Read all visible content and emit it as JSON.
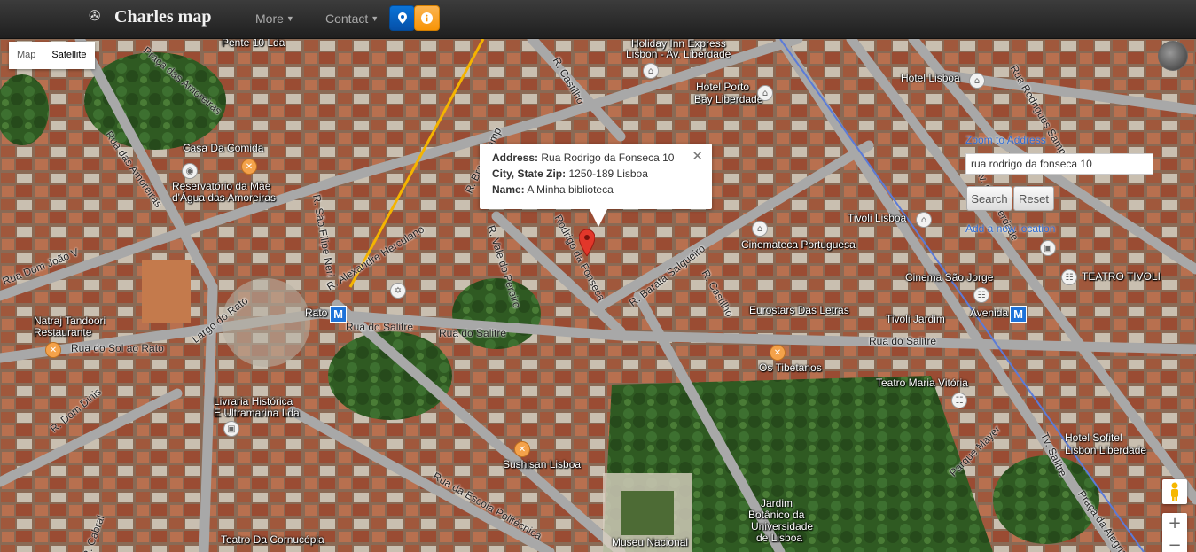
{
  "navbar": {
    "brand": "Charles map",
    "brand_icon": "compass-icon",
    "menu": [
      {
        "label": "More"
      },
      {
        "label": "Contact"
      }
    ],
    "buttons": [
      {
        "icon": "map-marker-icon",
        "color": "#0a63c6"
      },
      {
        "icon": "info-icon",
        "color": "#f89406"
      }
    ]
  },
  "map_type": {
    "map_label": "Map",
    "satellite_label": "Satellite",
    "selected": "Satellite"
  },
  "info_window": {
    "address_label": "Address:",
    "address": "Rua Rodrigo da Fonseca 10",
    "city_label": "City, State Zip:",
    "city": "1250-189 Lisboa",
    "name_label": "Name:",
    "name": "A Minha biblioteca",
    "close_icon": "close-icon"
  },
  "panel": {
    "zoom_link": "Zoom to Address",
    "search_value": "rua rodrigo da fonseca 10",
    "search_label": "Search",
    "reset_label": "Reset",
    "add_link": "Add a new location"
  },
  "zoom": {
    "in": "+",
    "out": "−"
  },
  "map_labels": {
    "poi": [
      "Pente 10 Lda",
      "Holiday Inn Express",
      "Lisbon - Av. Liberdade",
      "Hotel Porto",
      "Bay Liberdade",
      "Hotel Lisboa",
      "Casa Da Comida",
      "Reservatório da Mãe",
      "d'Água das Amoreiras",
      "Tivoli Lisboa",
      "Cinemateca Portuguesa",
      "Cinema São Jorge",
      "TEATRO TIVOLI",
      "Natraj Tandoori",
      "Restaurante",
      "Eurostars Das Letras",
      "Tivoli Jardim",
      "Avenida",
      "Rato",
      "Os Tibetanos",
      "Teatro Maria Vitória",
      "Livraria Histórica",
      "E Ultramarina Lda",
      "Hotel Sofitel",
      "Lisbon Liberdade",
      "Sushisan Lisboa",
      "Jardim",
      "Botânico da",
      "Universidade",
      "de Lisboa",
      "Teatro Da Cornucópia",
      "Museu Nacional"
    ],
    "roads": [
      "Praça das Amoreiras",
      "Rua das Amoreiras",
      "R. São Filipe Neri",
      "R. Braamcamp",
      "R. Castilho",
      "R. Alexandre Herculano",
      "Rua Dom João V",
      "Largo do Rato",
      "R. Vale do Pereiro",
      "Rodrigo da Fonseca",
      "R. Barata Salgueiro",
      "Rua do Salitre",
      "Rua do Sol ao Rato",
      "R. Dom Dinis",
      "Rua da Escola Politécnica",
      "Av. da Liberdade",
      "Praça da Alegria",
      "R. Castilho",
      "Rua do Salitre",
      "Rua do Salitre",
      "Parque Mayer",
      "Tv. Salitre",
      "Rua Rodrigues Sampaio",
      "R. Cabral"
    ]
  }
}
